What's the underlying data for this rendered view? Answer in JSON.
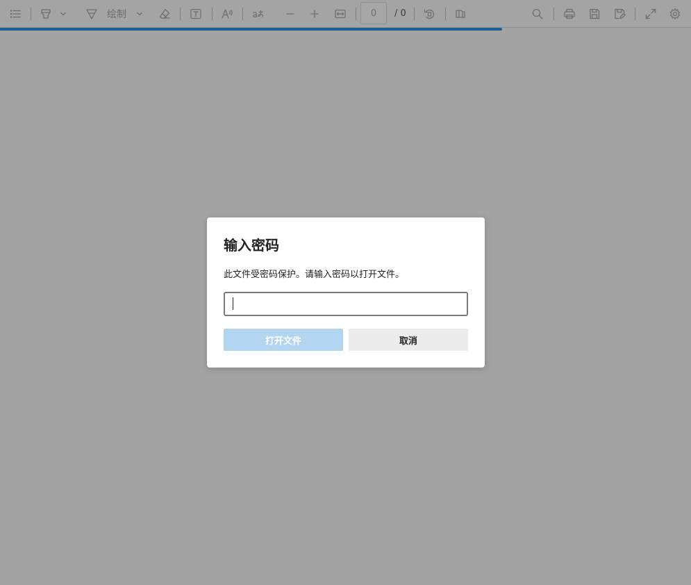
{
  "toolbar": {
    "draw_label": "绘制",
    "page_current": "0",
    "page_total": "/ 0",
    "icons": [
      "list-icon",
      "highlighter-icon",
      "draw-icon",
      "eraser-icon",
      "text-box-icon",
      "read-aloud-icon",
      "translate-icon",
      "zoom-out-icon",
      "zoom-in-icon",
      "fit-width-icon",
      "rotate-icon",
      "page-view-icon",
      "search-icon",
      "print-icon",
      "save-icon",
      "save-as-icon",
      "fullscreen-icon",
      "settings-icon"
    ]
  },
  "dialog": {
    "title": "输入密码",
    "message": "此文件受密码保护。请输入密码以打开文件。",
    "password_value": "",
    "open_label": "打开文件",
    "cancel_label": "取消"
  },
  "colors": {
    "background": "#a3a3a3",
    "progress": "#1a5f98",
    "open_button": "#b3d5f0",
    "cancel_button": "#ececec"
  }
}
